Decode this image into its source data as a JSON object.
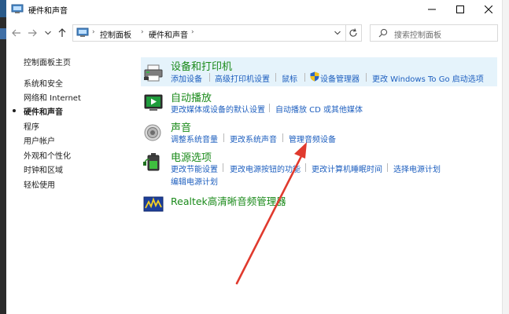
{
  "window": {
    "title": "硬件和声音"
  },
  "nav": {
    "breadcrumb": [
      "控制面板",
      "硬件和声音"
    ],
    "search_placeholder": "搜索控制面板"
  },
  "sidebar": {
    "items": [
      {
        "label": "控制面板主页",
        "current": false
      },
      {
        "label": "系统和安全",
        "current": false
      },
      {
        "label": "网络和 Internet",
        "current": false
      },
      {
        "label": "硬件和声音",
        "current": true
      },
      {
        "label": "程序",
        "current": false
      },
      {
        "label": "用户帐户",
        "current": false
      },
      {
        "label": "外观和个性化",
        "current": false
      },
      {
        "label": "时钟和区域",
        "current": false
      },
      {
        "label": "轻松使用",
        "current": false
      }
    ]
  },
  "categories": [
    {
      "title": "设备和打印机",
      "icon": "printer-icon",
      "links": [
        "添加设备",
        "高级打印机设置",
        "鼠标",
        "设备管理器",
        "更改 Windows To Go 启动选项"
      ]
    },
    {
      "title": "自动播放",
      "icon": "autoplay-icon",
      "links": [
        "更改媒体或设备的默认设置",
        "自动播放 CD 或其他媒体"
      ]
    },
    {
      "title": "声音",
      "icon": "speaker-icon",
      "links": [
        "调整系统音量",
        "更改系统声音",
        "管理音频设备"
      ]
    },
    {
      "title": "电源选项",
      "icon": "power-battery-icon",
      "links": [
        "更改节能设置",
        "更改电源按钮的功能",
        "更改计算机睡眠时间",
        "选择电源计划",
        "编辑电源计划"
      ]
    },
    {
      "title": "Realtek高清晰音频管理器",
      "icon": "realtek-audio-icon",
      "links": []
    }
  ],
  "colors": {
    "link": "#1e5fbf",
    "category_title": "#1a8a1a",
    "highlight": "#e5f3fb",
    "annotation_arrow": "#e03a2e"
  }
}
